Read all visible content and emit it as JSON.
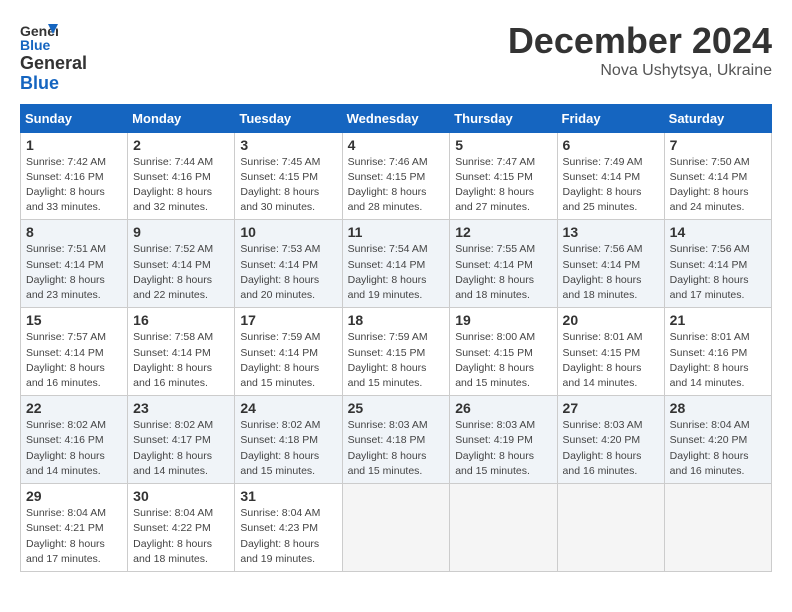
{
  "header": {
    "logo_line1": "General",
    "logo_line2": "Blue",
    "month": "December 2024",
    "location": "Nova Ushytsya, Ukraine"
  },
  "weekdays": [
    "Sunday",
    "Monday",
    "Tuesday",
    "Wednesday",
    "Thursday",
    "Friday",
    "Saturday"
  ],
  "weeks": [
    [
      {
        "day": "1",
        "info": "Sunrise: 7:42 AM\nSunset: 4:16 PM\nDaylight: 8 hours\nand 33 minutes."
      },
      {
        "day": "2",
        "info": "Sunrise: 7:44 AM\nSunset: 4:16 PM\nDaylight: 8 hours\nand 32 minutes."
      },
      {
        "day": "3",
        "info": "Sunrise: 7:45 AM\nSunset: 4:15 PM\nDaylight: 8 hours\nand 30 minutes."
      },
      {
        "day": "4",
        "info": "Sunrise: 7:46 AM\nSunset: 4:15 PM\nDaylight: 8 hours\nand 28 minutes."
      },
      {
        "day": "5",
        "info": "Sunrise: 7:47 AM\nSunset: 4:15 PM\nDaylight: 8 hours\nand 27 minutes."
      },
      {
        "day": "6",
        "info": "Sunrise: 7:49 AM\nSunset: 4:14 PM\nDaylight: 8 hours\nand 25 minutes."
      },
      {
        "day": "7",
        "info": "Sunrise: 7:50 AM\nSunset: 4:14 PM\nDaylight: 8 hours\nand 24 minutes."
      }
    ],
    [
      {
        "day": "8",
        "info": "Sunrise: 7:51 AM\nSunset: 4:14 PM\nDaylight: 8 hours\nand 23 minutes."
      },
      {
        "day": "9",
        "info": "Sunrise: 7:52 AM\nSunset: 4:14 PM\nDaylight: 8 hours\nand 22 minutes."
      },
      {
        "day": "10",
        "info": "Sunrise: 7:53 AM\nSunset: 4:14 PM\nDaylight: 8 hours\nand 20 minutes."
      },
      {
        "day": "11",
        "info": "Sunrise: 7:54 AM\nSunset: 4:14 PM\nDaylight: 8 hours\nand 19 minutes."
      },
      {
        "day": "12",
        "info": "Sunrise: 7:55 AM\nSunset: 4:14 PM\nDaylight: 8 hours\nand 18 minutes."
      },
      {
        "day": "13",
        "info": "Sunrise: 7:56 AM\nSunset: 4:14 PM\nDaylight: 8 hours\nand 18 minutes."
      },
      {
        "day": "14",
        "info": "Sunrise: 7:56 AM\nSunset: 4:14 PM\nDaylight: 8 hours\nand 17 minutes."
      }
    ],
    [
      {
        "day": "15",
        "info": "Sunrise: 7:57 AM\nSunset: 4:14 PM\nDaylight: 8 hours\nand 16 minutes."
      },
      {
        "day": "16",
        "info": "Sunrise: 7:58 AM\nSunset: 4:14 PM\nDaylight: 8 hours\nand 16 minutes."
      },
      {
        "day": "17",
        "info": "Sunrise: 7:59 AM\nSunset: 4:14 PM\nDaylight: 8 hours\nand 15 minutes."
      },
      {
        "day": "18",
        "info": "Sunrise: 7:59 AM\nSunset: 4:15 PM\nDaylight: 8 hours\nand 15 minutes."
      },
      {
        "day": "19",
        "info": "Sunrise: 8:00 AM\nSunset: 4:15 PM\nDaylight: 8 hours\nand 15 minutes."
      },
      {
        "day": "20",
        "info": "Sunrise: 8:01 AM\nSunset: 4:15 PM\nDaylight: 8 hours\nand 14 minutes."
      },
      {
        "day": "21",
        "info": "Sunrise: 8:01 AM\nSunset: 4:16 PM\nDaylight: 8 hours\nand 14 minutes."
      }
    ],
    [
      {
        "day": "22",
        "info": "Sunrise: 8:02 AM\nSunset: 4:16 PM\nDaylight: 8 hours\nand 14 minutes."
      },
      {
        "day": "23",
        "info": "Sunrise: 8:02 AM\nSunset: 4:17 PM\nDaylight: 8 hours\nand 14 minutes."
      },
      {
        "day": "24",
        "info": "Sunrise: 8:02 AM\nSunset: 4:18 PM\nDaylight: 8 hours\nand 15 minutes."
      },
      {
        "day": "25",
        "info": "Sunrise: 8:03 AM\nSunset: 4:18 PM\nDaylight: 8 hours\nand 15 minutes."
      },
      {
        "day": "26",
        "info": "Sunrise: 8:03 AM\nSunset: 4:19 PM\nDaylight: 8 hours\nand 15 minutes."
      },
      {
        "day": "27",
        "info": "Sunrise: 8:03 AM\nSunset: 4:20 PM\nDaylight: 8 hours\nand 16 minutes."
      },
      {
        "day": "28",
        "info": "Sunrise: 8:04 AM\nSunset: 4:20 PM\nDaylight: 8 hours\nand 16 minutes."
      }
    ],
    [
      {
        "day": "29",
        "info": "Sunrise: 8:04 AM\nSunset: 4:21 PM\nDaylight: 8 hours\nand 17 minutes."
      },
      {
        "day": "30",
        "info": "Sunrise: 8:04 AM\nSunset: 4:22 PM\nDaylight: 8 hours\nand 18 minutes."
      },
      {
        "day": "31",
        "info": "Sunrise: 8:04 AM\nSunset: 4:23 PM\nDaylight: 8 hours\nand 19 minutes."
      },
      null,
      null,
      null,
      null
    ]
  ]
}
